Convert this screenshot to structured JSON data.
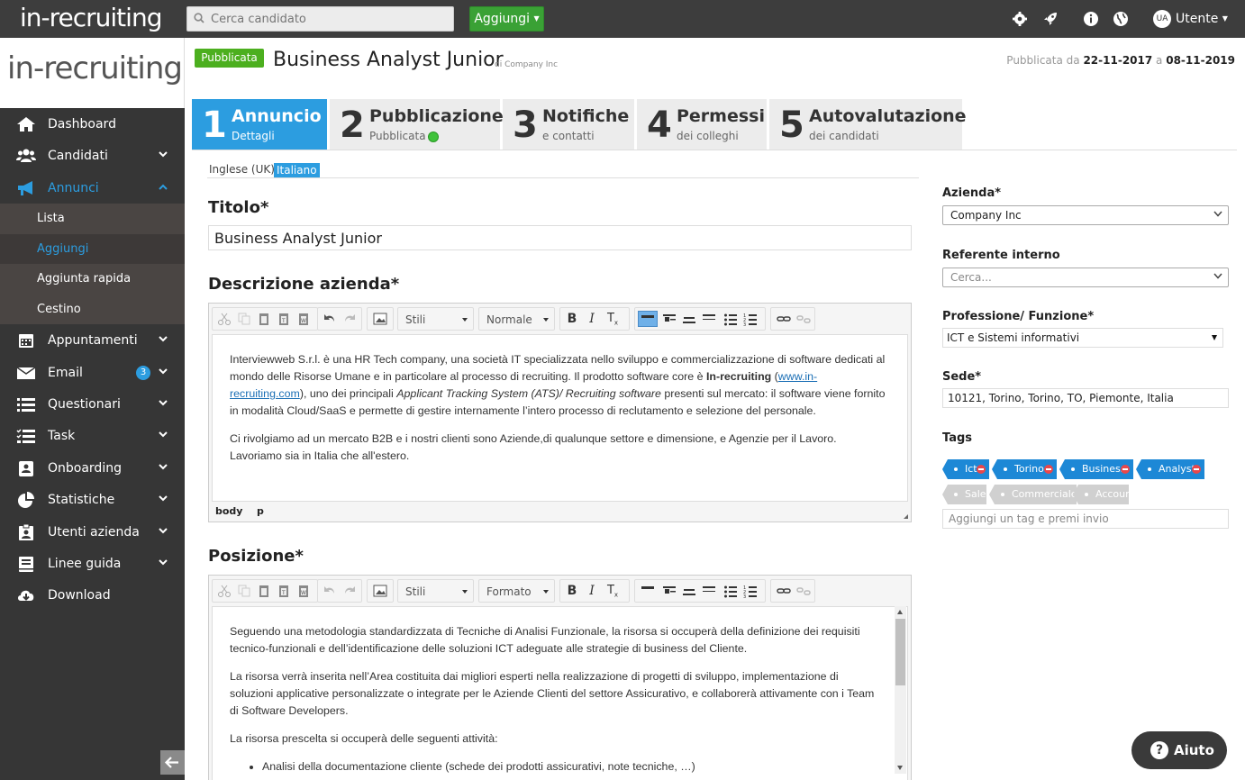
{
  "topbar": {
    "logo": "in-recruiting",
    "search_placeholder": "Cerca candidato",
    "add_button": "Aggiungi",
    "user_initials": "UA",
    "user_name": "Utente",
    "icons": [
      "gear-icon",
      "rocket-icon",
      "info-icon",
      "globe-icon"
    ]
  },
  "sidebar": {
    "logo": "in-recruiting",
    "items": [
      {
        "label": "Dashboard",
        "icon": "home-icon"
      },
      {
        "label": "Candidati",
        "icon": "users-icon"
      },
      {
        "label": "Annunci",
        "icon": "megaphone-icon"
      },
      {
        "label": "Appuntamenti",
        "icon": "calendar-icon"
      },
      {
        "label": "Email",
        "icon": "envelope-icon",
        "badge": "3"
      },
      {
        "label": "Questionari",
        "icon": "list-icon"
      },
      {
        "label": "Task",
        "icon": "tasks-icon"
      },
      {
        "label": "Onboarding",
        "icon": "onboarding-icon"
      },
      {
        "label": "Statistiche",
        "icon": "pie-chart-icon"
      },
      {
        "label": "Utenti azienda",
        "icon": "id-badge-icon"
      },
      {
        "label": "Linee guida",
        "icon": "book-icon"
      },
      {
        "label": "Download",
        "icon": "download-icon"
      }
    ],
    "annunci_sub": [
      "Lista",
      "Aggiungi",
      "Aggiunta rapida",
      "Cestino"
    ]
  },
  "header": {
    "status": "Pubblicata",
    "title": "Business Analyst Junior",
    "company": "di Company Inc",
    "pub_prefix": "Pubblicata da",
    "pub_from": "22-11-2017",
    "pub_sep": "a",
    "pub_to": "08-11-2019"
  },
  "tabs": [
    {
      "num": "1",
      "title": "Annuncio",
      "sub": "Dettagli"
    },
    {
      "num": "2",
      "title": "Pubblicazione",
      "sub": "Pubblicata"
    },
    {
      "num": "3",
      "title": "Notifiche",
      "sub": "e contatti"
    },
    {
      "num": "4",
      "title": "Permessi",
      "sub": "dei colleghi"
    },
    {
      "num": "5",
      "title": "Autovalutazione",
      "sub": "dei candidati"
    }
  ],
  "languages": [
    "Inglese (UK)",
    "Italiano"
  ],
  "form": {
    "title_label": "Titolo*",
    "title_value": "Business Analyst Junior",
    "desc_label": "Descrizione azienda*",
    "pos_label": "Posizione*",
    "editor1": {
      "styles": "Stili",
      "format": "Normale",
      "p1a": "Interview",
      "p1": "Interviewweb S.r.l. è una HR Tech company, una società IT specializzata nello sviluppo e commercializzazione di software dedicati al mondo delle Risorse Umane e in particolare al processo di recruiting. Il prodotto software core è",
      "p1_bold": "In-recruiting",
      "p1_link": "www.in-recruiting.com",
      "p1_b": "), uno dei principali",
      "p1_italic": "Applicant Tracking System (ATS)/ Recruiting software",
      "p1_c": "presenti sul mercato: il software viene fornito in modalità Cloud/SaaS e permette di gestire internamente l’intero processo di reclutamento e selezione del personale.",
      "p2": "Ci rivolgiamo ad un mercato B2B e i nostri clienti sono Aziende,di qualunque settore e dimensione, e Agenzie per il Lavoro. Lavoriamo sia in Italia che all'estero.",
      "path": [
        "body",
        "p"
      ]
    },
    "editor2": {
      "styles": "Stili",
      "format": "Formato",
      "p1": "Seguendo una metodologia standardizzata di Tecniche di Analisi Funzionale, la risorsa si occuperà della definizione dei requisiti tecnico-funzionali e dell’identificazione delle soluzioni ICT adeguate alle strategie di business del Cliente.",
      "p2": "La risorsa verrà inserita nell’Area costituita dai migliori esperti nella realizzazione di progetti di sviluppo, implementazione di soluzioni applicative personalizzate o integrate per le Aziende Clienti del settore Assicurativo, e collaborerà attivamente con i Team di Software Developers.",
      "p3": "La risorsa prescelta si occuperà delle seguenti attività:",
      "li1": "Analisi della documentazione cliente (schede dei prodotti assicurativi, note tecniche, …)"
    }
  },
  "right": {
    "azienda_label": "Azienda*",
    "azienda_value": "Company Inc",
    "referente_label": "Referente interno",
    "referente_placeholder": "Cerca...",
    "professione_label": "Professione/ Funzione*",
    "professione_value": "ICT e Sistemi informativi",
    "sede_label": "Sede*",
    "sede_value": "10121, Torino, Torino, TO, Piemonte, Italia",
    "tags_label": "Tags",
    "tags_active": [
      "Ict",
      "Torino",
      "Business",
      "Analyst"
    ],
    "tags_suggested": [
      "Sales",
      "Commerciale",
      "Account"
    ],
    "tag_placeholder": "Aggiungi un tag e premi invio"
  },
  "help": {
    "label": "Aiuto"
  },
  "colors": {
    "brand_blue": "#2c9de0",
    "green": "#3aa135",
    "dark": "#363636",
    "tag_blue": "#1d88d6"
  }
}
